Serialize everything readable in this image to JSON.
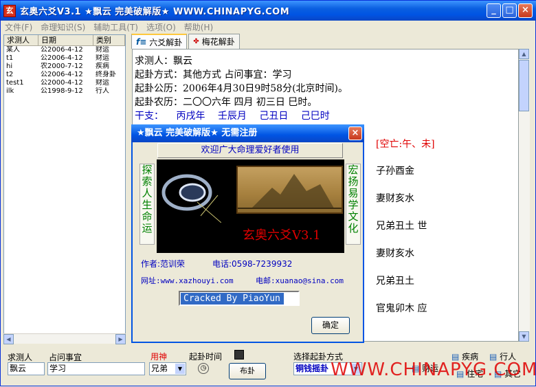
{
  "window": {
    "title": "玄奥六爻V3.1 ★飘云 完美破解版★ WWW.CHINAPYG.COM"
  },
  "menu": [
    "文件(F)",
    "命理知识(S)",
    "辅助工具(T)",
    "选项(O)",
    "帮助(H)"
  ],
  "list": {
    "headers": [
      "求测人",
      "日期",
      "类别"
    ],
    "rows": [
      [
        "某人",
        "公2006-4-12",
        "财运"
      ],
      [
        "t1",
        "公2006-4-12",
        "财运"
      ],
      [
        "hi",
        "农2000-7-12",
        "疾病"
      ],
      [
        "t2",
        "公2006-4-12",
        "终身卦"
      ],
      [
        "test1",
        "公2000-4-12",
        "财运"
      ],
      [
        "ilk",
        "公1998-9-12",
        "行人"
      ]
    ]
  },
  "tabs": [
    {
      "label": "六爻解卦",
      "icon": "fx-icon"
    },
    {
      "label": "梅花解卦",
      "icon": "plum-icon"
    }
  ],
  "content": {
    "lines": [
      "求测人：飘云",
      "起卦方式：其他方式    占问事宜：学习",
      "起卦公历：2006年4月30日9时58分(北京时间)。",
      "起卦农历：二〇〇六年 四月 初三日 巳时。"
    ],
    "ganzhi_label": "干支：",
    "ganzhi": [
      "丙戌年",
      "壬辰月",
      "己丑日",
      "己巳时"
    ],
    "kongwang": "[空亡:午、未]",
    "yao": [
      "子孙酉金",
      "妻财亥水",
      "兄弟丑土 世",
      "妻财亥水",
      "兄弟丑土",
      "官鬼卯木 应"
    ]
  },
  "dialog": {
    "title": "★飘云 完美破解版★ 无需注册",
    "welcome": "欢迎广大命理爱好者使用",
    "left_vertical": "探索人生命运",
    "right_vertical": "宏扬易学文化",
    "banner_title": "玄奥六爻V3.1",
    "author": "作者:范训荣",
    "phone": "电话:0598-7239932",
    "website": "网址:www.xazhouyi.com",
    "email": "电邮:xuanao@sina.com",
    "cracked": "Cracked By PiaoYun",
    "ok": "确定"
  },
  "bottom": {
    "person_label": "求测人",
    "person_value": "飘云",
    "matter_label": "占问事宜",
    "matter_value": "学习",
    "yongshen_label": "用神",
    "yongshen_value": "兄弟",
    "time_label": "起卦时间",
    "start_button": "布卦",
    "method_label": "选择起卦方式",
    "method_value": "铜钱摇卦",
    "categories": [
      "财运",
      "疾病",
      "行人",
      "住宅",
      "其它"
    ]
  },
  "watermark": "WWW.CHINAPYG.COM",
  "colors": {
    "title_blue": "#0054e3",
    "ganzhi_blue": "#0000c0",
    "kongwang_red": "#e00000",
    "vertical_green": "#008000"
  }
}
